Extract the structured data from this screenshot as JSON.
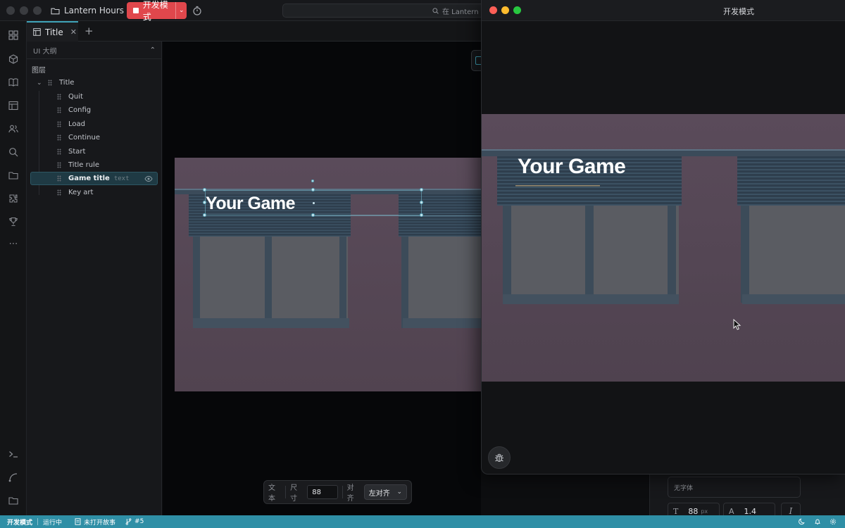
{
  "titlebar": {
    "project_name": "Lantern Hours",
    "dev_mode_label": "开发模式",
    "search_text": "在 Lantern Ho"
  },
  "tabs": [
    {
      "label": "Title",
      "active": true
    }
  ],
  "outline": {
    "header": "UI 大纲",
    "layers_label": "图层",
    "root": "Title",
    "items": [
      {
        "label": "Quit"
      },
      {
        "label": "Config"
      },
      {
        "label": "Load"
      },
      {
        "label": "Continue"
      },
      {
        "label": "Start"
      },
      {
        "label": "Title rule"
      },
      {
        "label": "Game title",
        "tag": "text",
        "selected": true
      },
      {
        "label": "Key art"
      }
    ]
  },
  "canvas": {
    "game_title": "Your Game"
  },
  "text_toolbar": {
    "type_label": "文本",
    "size_label": "尺寸",
    "size_value": "88",
    "align_label": "对齐",
    "align_value": "左对齐"
  },
  "inspector": {
    "font_placeholder": "无字体",
    "font_size": "88",
    "font_size_unit": "px",
    "line_height": "1.4"
  },
  "dev_window": {
    "title": "开发模式",
    "game_title": "Your Game"
  },
  "statusbar": {
    "mode": "开发模式",
    "running": "运行中",
    "story": "未打开故事",
    "branch": "#5"
  },
  "colors": {
    "accent": "#3fa3b8",
    "dev_mode": "#e0474c",
    "statusbar": "#2f8fa6"
  }
}
